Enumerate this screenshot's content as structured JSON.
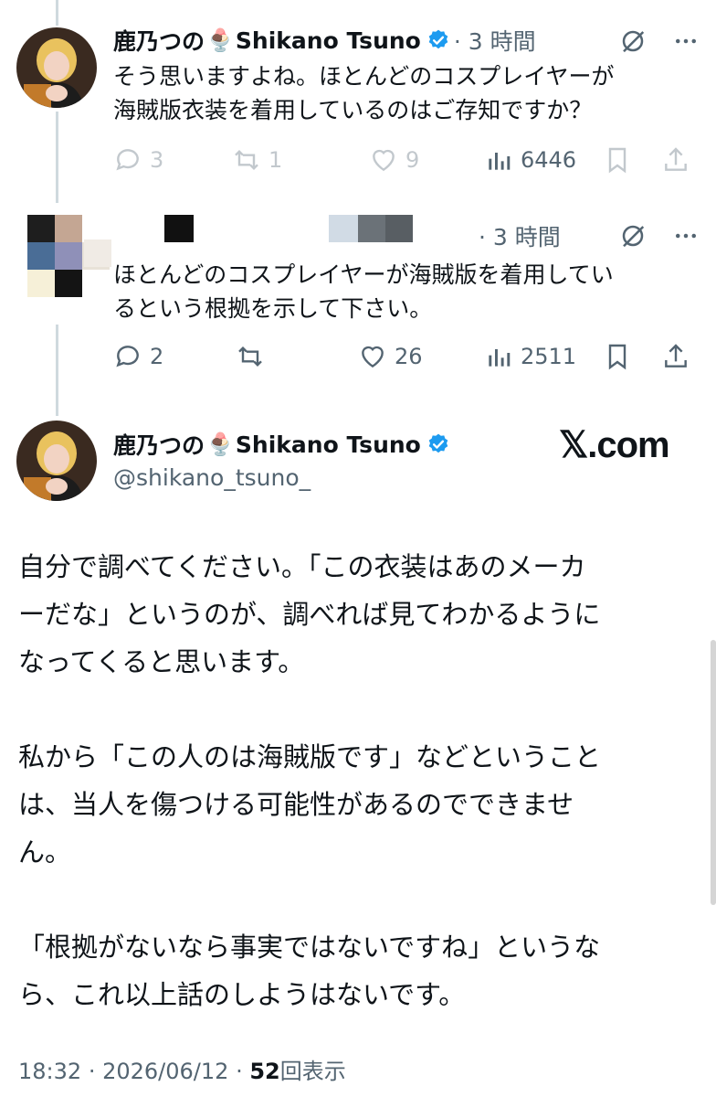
{
  "tweet1": {
    "display_name": "鹿乃つの",
    "emoji": "🍨",
    "name_latin": "Shikano Tsuno",
    "time": "· 3 時間",
    "text_line1": "そう思いますよね。ほとんどのコスプレイヤーが",
    "text_line2": "海賊版衣装を着用しているのはご存知ですか？",
    "stats": {
      "replies": "3",
      "reposts": "1",
      "likes": "9",
      "views": "6446"
    }
  },
  "tweet2": {
    "time": "· 3 時間",
    "text_line1": "ほとんどのコスプレイヤーが海賊版を着用してい",
    "text_line2": "るという根拠を示して下さい。",
    "stats": {
      "replies": "2",
      "likes": "26",
      "views": "2511"
    },
    "redacted": true
  },
  "main_tweet": {
    "display_name": "鹿乃つの",
    "emoji": "🍨",
    "name_latin": "Shikano Tsuno",
    "handle": "@shikano_tsuno_",
    "watermark": "𝕏.com",
    "paragraphs": [
      [
        "自分で調べてください。「この衣装はあのメーカ",
        "ーだな」というのが、調べれば見てわかるように",
        "なってくると思います。"
      ],
      [
        "私から「この人のは海賊版です」などということ",
        "は、当人を傷つける可能性があるのでできませ",
        "ん。"
      ],
      [
        "「根拠がないなら事実ではないですね」というな",
        "ら、これ以上話のしようはないです。"
      ]
    ],
    "footer": {
      "time": "18:32",
      "date": "2026/06/12",
      "sep": "·",
      "views": "52",
      "views_label": "回表示"
    }
  },
  "colors": {
    "verified": "#1d9bf0",
    "muted": "#536471",
    "thread_line": "#cfd9de"
  }
}
